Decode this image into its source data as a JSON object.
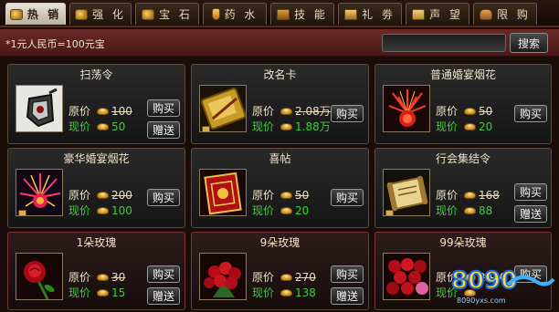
{
  "tabs": [
    {
      "label": "热 销",
      "icon": "coin-icon",
      "active": true
    },
    {
      "label": "强 化",
      "icon": "coin-icon",
      "active": false
    },
    {
      "label": "宝 石",
      "icon": "coin-icon",
      "active": false
    },
    {
      "label": "药 水",
      "icon": "potion-icon",
      "active": false
    },
    {
      "label": "技 能",
      "icon": "book-icon",
      "active": false
    },
    {
      "label": "礼 劵",
      "icon": "ticket-icon",
      "active": false
    },
    {
      "label": "声 望",
      "icon": "scroll-icon",
      "active": false
    },
    {
      "label": "限 购",
      "icon": "bag-icon",
      "active": false
    }
  ],
  "header": {
    "note": "*1元人民币=100元宝",
    "search_button": "搜索",
    "search_placeholder": ""
  },
  "labels": {
    "original_price": "原价",
    "current_price": "现价",
    "buy": "购买",
    "gift": "赠送"
  },
  "items": [
    {
      "name": "扫荡令",
      "original": "100",
      "current": "50",
      "icon": "sweep-token-icon",
      "gift": true
    },
    {
      "name": "改名卡",
      "original": "2.08万",
      "current": "1.88万",
      "icon": "rename-card-icon",
      "gift": false
    },
    {
      "name": "普通婚宴烟花",
      "original": "50",
      "current": "20",
      "icon": "fireworks-icon",
      "gift": false
    },
    {
      "name": "豪华婚宴烟花",
      "original": "200",
      "current": "100",
      "icon": "fireworks-icon",
      "gift": false
    },
    {
      "name": "喜帖",
      "original": "50",
      "current": "20",
      "icon": "wedding-invitation-icon",
      "gift": false
    },
    {
      "name": "行会集结令",
      "original": "168",
      "current": "88",
      "icon": "guild-scroll-icon",
      "gift": true
    },
    {
      "name": "1朵玫瑰",
      "original": "30",
      "current": "15",
      "icon": "rose-icon",
      "gift": true
    },
    {
      "name": "9朵玫瑰",
      "original": "270",
      "current": "138",
      "icon": "rose-bouquet-icon",
      "gift": true
    },
    {
      "name": "99朵玫瑰",
      "original": "2970",
      "current": "",
      "icon": "rose-bouquet-icon",
      "gift": false
    }
  ],
  "watermark": {
    "text": "8090",
    "subtext": "8090yxs.com"
  }
}
